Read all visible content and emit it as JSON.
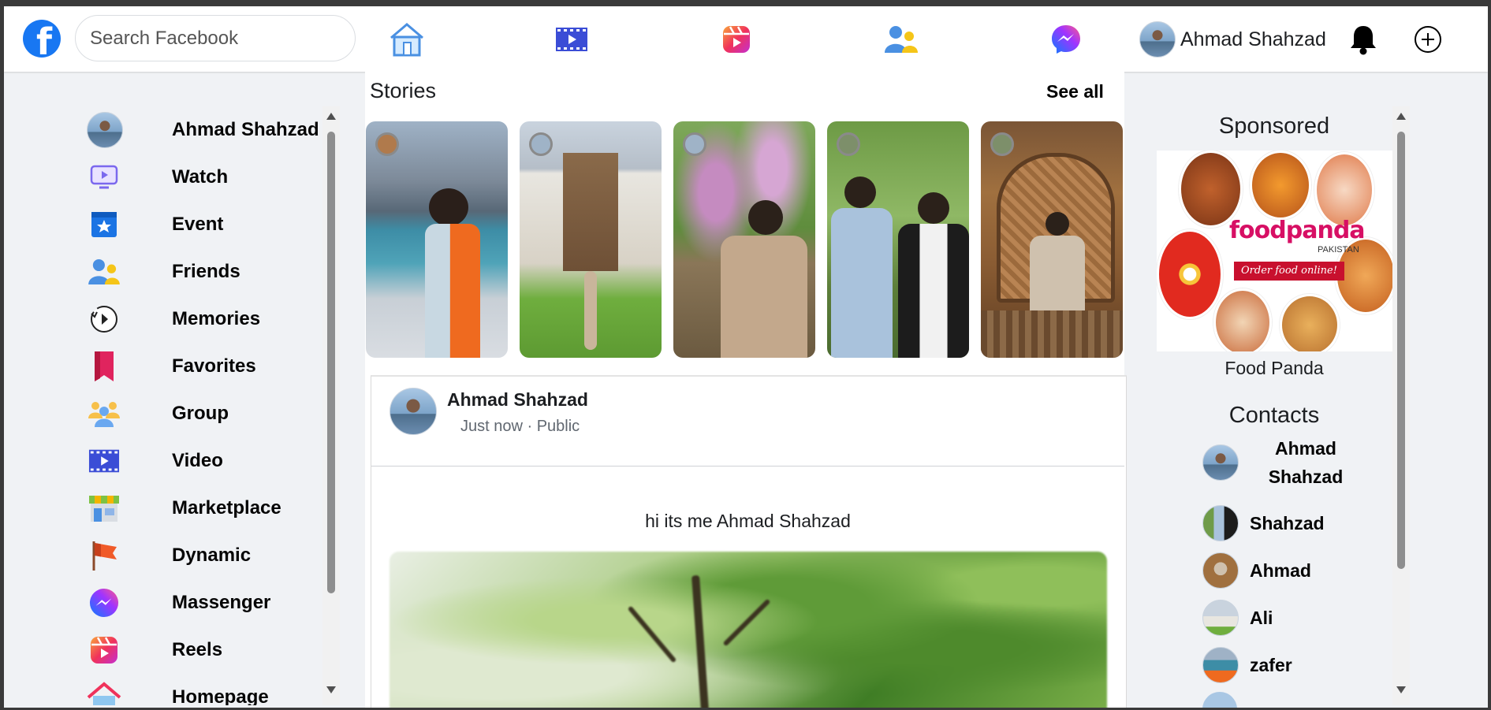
{
  "topbar": {
    "logo_icon": "facebook-logo-icon",
    "search_placeholder": "Search Facebook",
    "nav_icons": [
      "home-icon",
      "watch-video-icon",
      "reels-icon",
      "friends-icon",
      "messenger-icon"
    ],
    "profile_name": "Ahmad Shahzad",
    "notification_icon": "bell-icon",
    "create_icon": "plus-circle-icon"
  },
  "sidebar": {
    "items": [
      {
        "label": "Ahmad Shahzad",
        "icon": "profile-avatar"
      },
      {
        "label": "Watch",
        "icon": "watch-icon"
      },
      {
        "label": "Event",
        "icon": "calendar-star-icon"
      },
      {
        "label": "Friends",
        "icon": "friends-icon"
      },
      {
        "label": "Memories",
        "icon": "clock-history-icon"
      },
      {
        "label": "Favorites",
        "icon": "bookmark-icon"
      },
      {
        "label": "Group",
        "icon": "group-icon"
      },
      {
        "label": "Video",
        "icon": "video-film-icon"
      },
      {
        "label": "Marketplace",
        "icon": "store-icon"
      },
      {
        "label": "Dynamic",
        "icon": "flag-icon"
      },
      {
        "label": "Massenger",
        "icon": "messenger-icon"
      },
      {
        "label": "Reels",
        "icon": "reels-icon"
      },
      {
        "label": "Homepage",
        "icon": "home-icon"
      }
    ]
  },
  "stories": {
    "title": "Stories",
    "see_all": "See all"
  },
  "post": {
    "author": "Ahmad Shahzad",
    "meta": "Just now · Public",
    "text": "hi its me Ahmad Shahzad"
  },
  "right": {
    "sponsored_title": "Sponsored",
    "ad_brand": "foodpanda",
    "ad_sub": "PAKISTAN",
    "ad_banner": "Order food online!",
    "ad_caption": "Food Panda",
    "contacts_title": "Contacts",
    "contacts": [
      "Ahmad Shahzad",
      "Shahzad",
      "Ahmad",
      "Ali",
      "zafer"
    ]
  },
  "colors": {
    "facebook_blue": "#1877f2",
    "background": "#f0f2f5",
    "foodpanda_pink": "#d70f64"
  }
}
